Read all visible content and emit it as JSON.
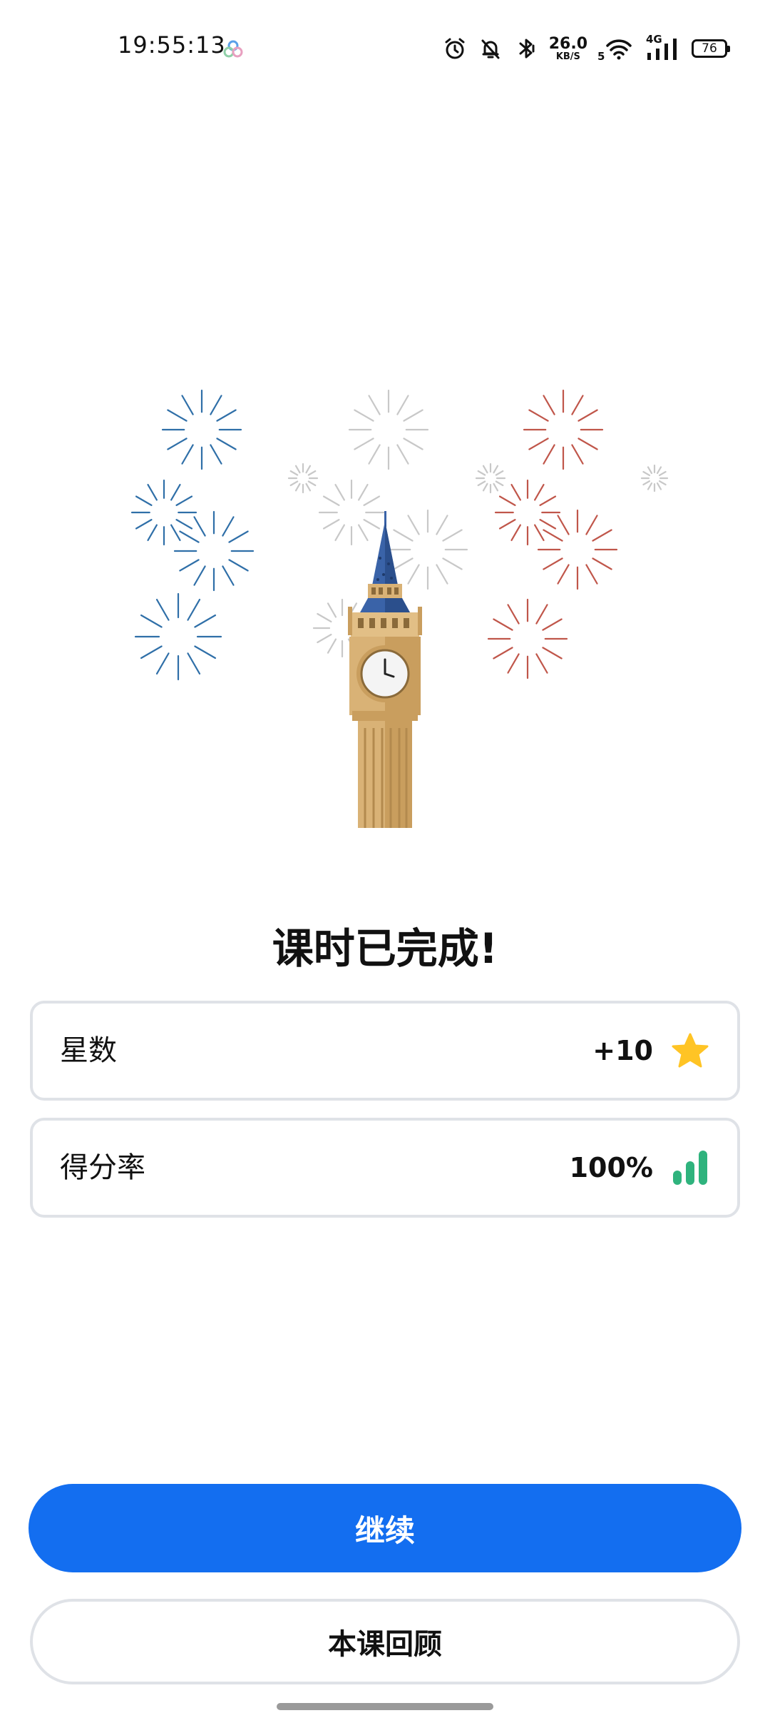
{
  "status_bar": {
    "time": "19:55:13",
    "net_speed_value": "26.0",
    "net_speed_unit": "KB/S",
    "wifi_label": "5",
    "signal_label": "4G",
    "battery": "76"
  },
  "title": "课时已完成!",
  "stats": {
    "stars": {
      "label": "星数",
      "value": "+10",
      "icon": "star-icon",
      "color": "#ffc425"
    },
    "score": {
      "label": "得分率",
      "value": "100%",
      "icon": "bar-chart-icon",
      "color": "#2fb37d"
    }
  },
  "buttons": {
    "continue": "继续",
    "review": "本课回顾"
  },
  "colors": {
    "primary": "#136ef0",
    "card_border": "#dfe2e7",
    "firework_blue": "#2f6fa8",
    "firework_red": "#c0564a",
    "tower_gold": "#d9b276",
    "spire_blue": "#3a63a8"
  }
}
